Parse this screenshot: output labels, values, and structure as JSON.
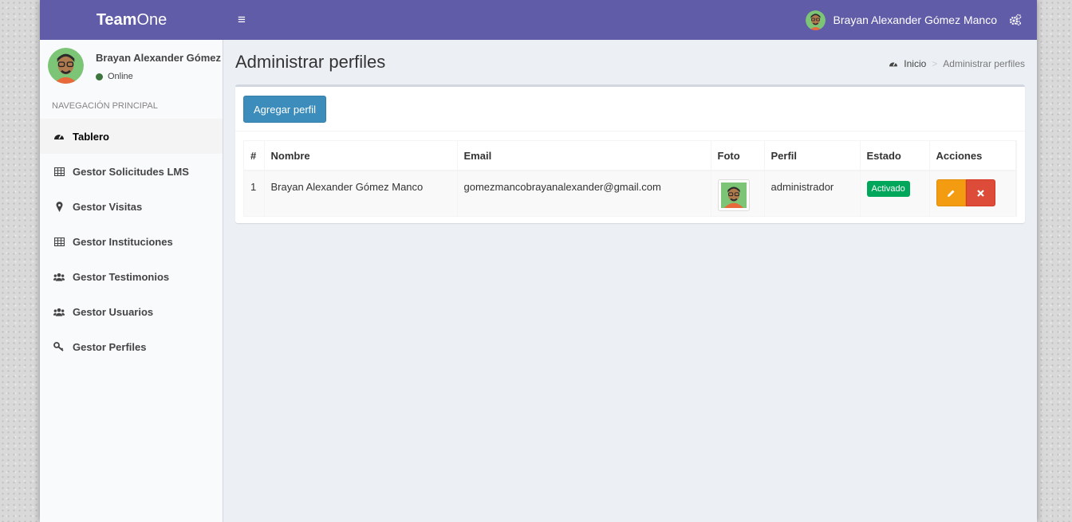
{
  "header": {
    "logo_bold": "Team",
    "logo_light": "One",
    "menu_toggle": "≡",
    "user_name": "Brayan Alexander Gómez Manco",
    "brand_color": "#605ca8"
  },
  "sidebar": {
    "user_name": "Brayan Alexander Gómez M",
    "status": "Online",
    "nav_header": "NAVEGACIÓN PRINCIPAL",
    "items": [
      {
        "label": "Tablero",
        "icon": "dashboard-icon",
        "active": true
      },
      {
        "label": "Gestor Solicitudes LMS",
        "icon": "table-icon"
      },
      {
        "label": "Gestor Visitas",
        "icon": "map-marker-icon"
      },
      {
        "label": "Gestor Instituciones",
        "icon": "table-icon"
      },
      {
        "label": "Gestor Testimonios",
        "icon": "users-icon"
      },
      {
        "label": "Gestor Usuarios",
        "icon": "users-icon"
      },
      {
        "label": "Gestor Perfiles",
        "icon": "key-icon"
      }
    ]
  },
  "content": {
    "title": "Administrar perfiles",
    "breadcrumb": {
      "home": "Inicio",
      "current": "Administrar perfiles"
    },
    "add_button": "Agregar perfil",
    "table": {
      "headers": [
        "#",
        "Nombre",
        "Email",
        "Foto",
        "Perfil",
        "Estado",
        "Acciones"
      ],
      "rows": [
        {
          "num": "1",
          "nombre": "Brayan Alexander Gómez Manco",
          "email": "gomezmancobrayanalexander@gmail.com",
          "perfil": "administrador",
          "estado": "Activado"
        }
      ]
    },
    "status_color": "#00a65a",
    "edit_color": "#f39c12",
    "delete_color": "#dd4b39"
  }
}
